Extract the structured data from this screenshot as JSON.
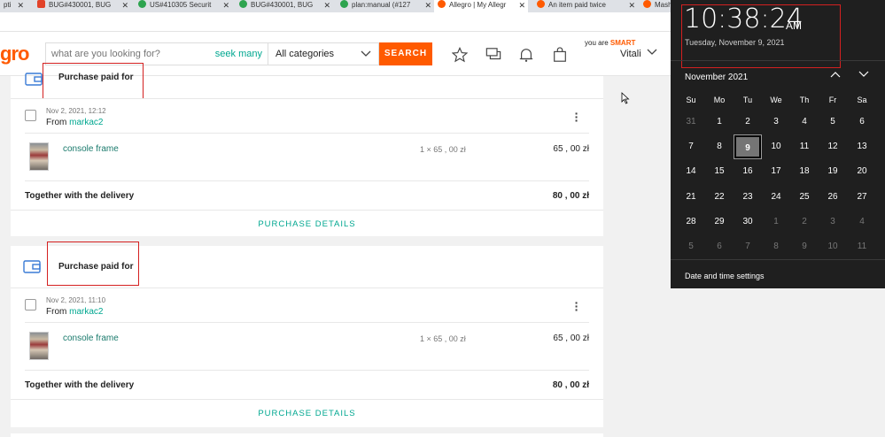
{
  "browser": {
    "tabs": [
      {
        "title": "pti",
        "color": "#555"
      },
      {
        "title": "BUG#430001, BUG",
        "color": "#e24329"
      },
      {
        "title": "US#410305 Securit",
        "color": "#2ea44f"
      },
      {
        "title": "BUG#430001, BUG",
        "color": "#2ea44f"
      },
      {
        "title": "plan:manual (#127",
        "color": "#2ea44f"
      },
      {
        "title": "Allegro | My Allegr",
        "color": "#ff5a00"
      },
      {
        "title": "An item paid twice",
        "color": "#ff5a00"
      },
      {
        "title": "Mashu",
        "color": "#ff5a00"
      }
    ]
  },
  "header": {
    "logo": "gro",
    "search_placeholder": "what are you looking for?",
    "seek_many": "seek many",
    "category": "All categories",
    "search_button": "SEARCH",
    "smart_prefix": "you are",
    "smart_label": "SMART",
    "user_name": "Vitali"
  },
  "orders": [
    {
      "status": "Purchase paid for",
      "date": "Nov 2, 2021, 12:12",
      "from_label": "From",
      "seller": "markac2",
      "item_name": "console frame",
      "qty": "1 × 65 , 00 zł",
      "price": "65 , 00 zł",
      "total_label": "Together with the delivery",
      "total": "80 , 00 zł",
      "details": "PURCHASE DETAILS"
    },
    {
      "status": "Purchase paid for",
      "date": "Nov 2, 2021, 11:10",
      "from_label": "From",
      "seller": "markac2",
      "item_name": "console frame",
      "qty": "1 × 65 , 00 zł",
      "price": "65 , 00 zł",
      "total_label": "Together with the delivery",
      "total": "80 , 00 zł",
      "details": "PURCHASE DETAILS"
    }
  ],
  "calendar": {
    "time": "10:38:24",
    "ampm": "AM",
    "full_date": "Tuesday, November 9, 2021",
    "month": "November 2021",
    "weekdays": [
      "Su",
      "Mo",
      "Tu",
      "We",
      "Th",
      "Fr",
      "Sa"
    ],
    "days": [
      "31",
      "1",
      "2",
      "3",
      "4",
      "5",
      "6",
      "7",
      "8",
      "9",
      "10",
      "11",
      "12",
      "13",
      "14",
      "15",
      "16",
      "17",
      "18",
      "19",
      "20",
      "21",
      "22",
      "23",
      "24",
      "25",
      "26",
      "27",
      "28",
      "29",
      "30",
      "1",
      "2",
      "3",
      "4",
      "5",
      "6",
      "7",
      "8",
      "9",
      "10",
      "11"
    ],
    "today": "9",
    "settings_link": "Date and time settings"
  }
}
